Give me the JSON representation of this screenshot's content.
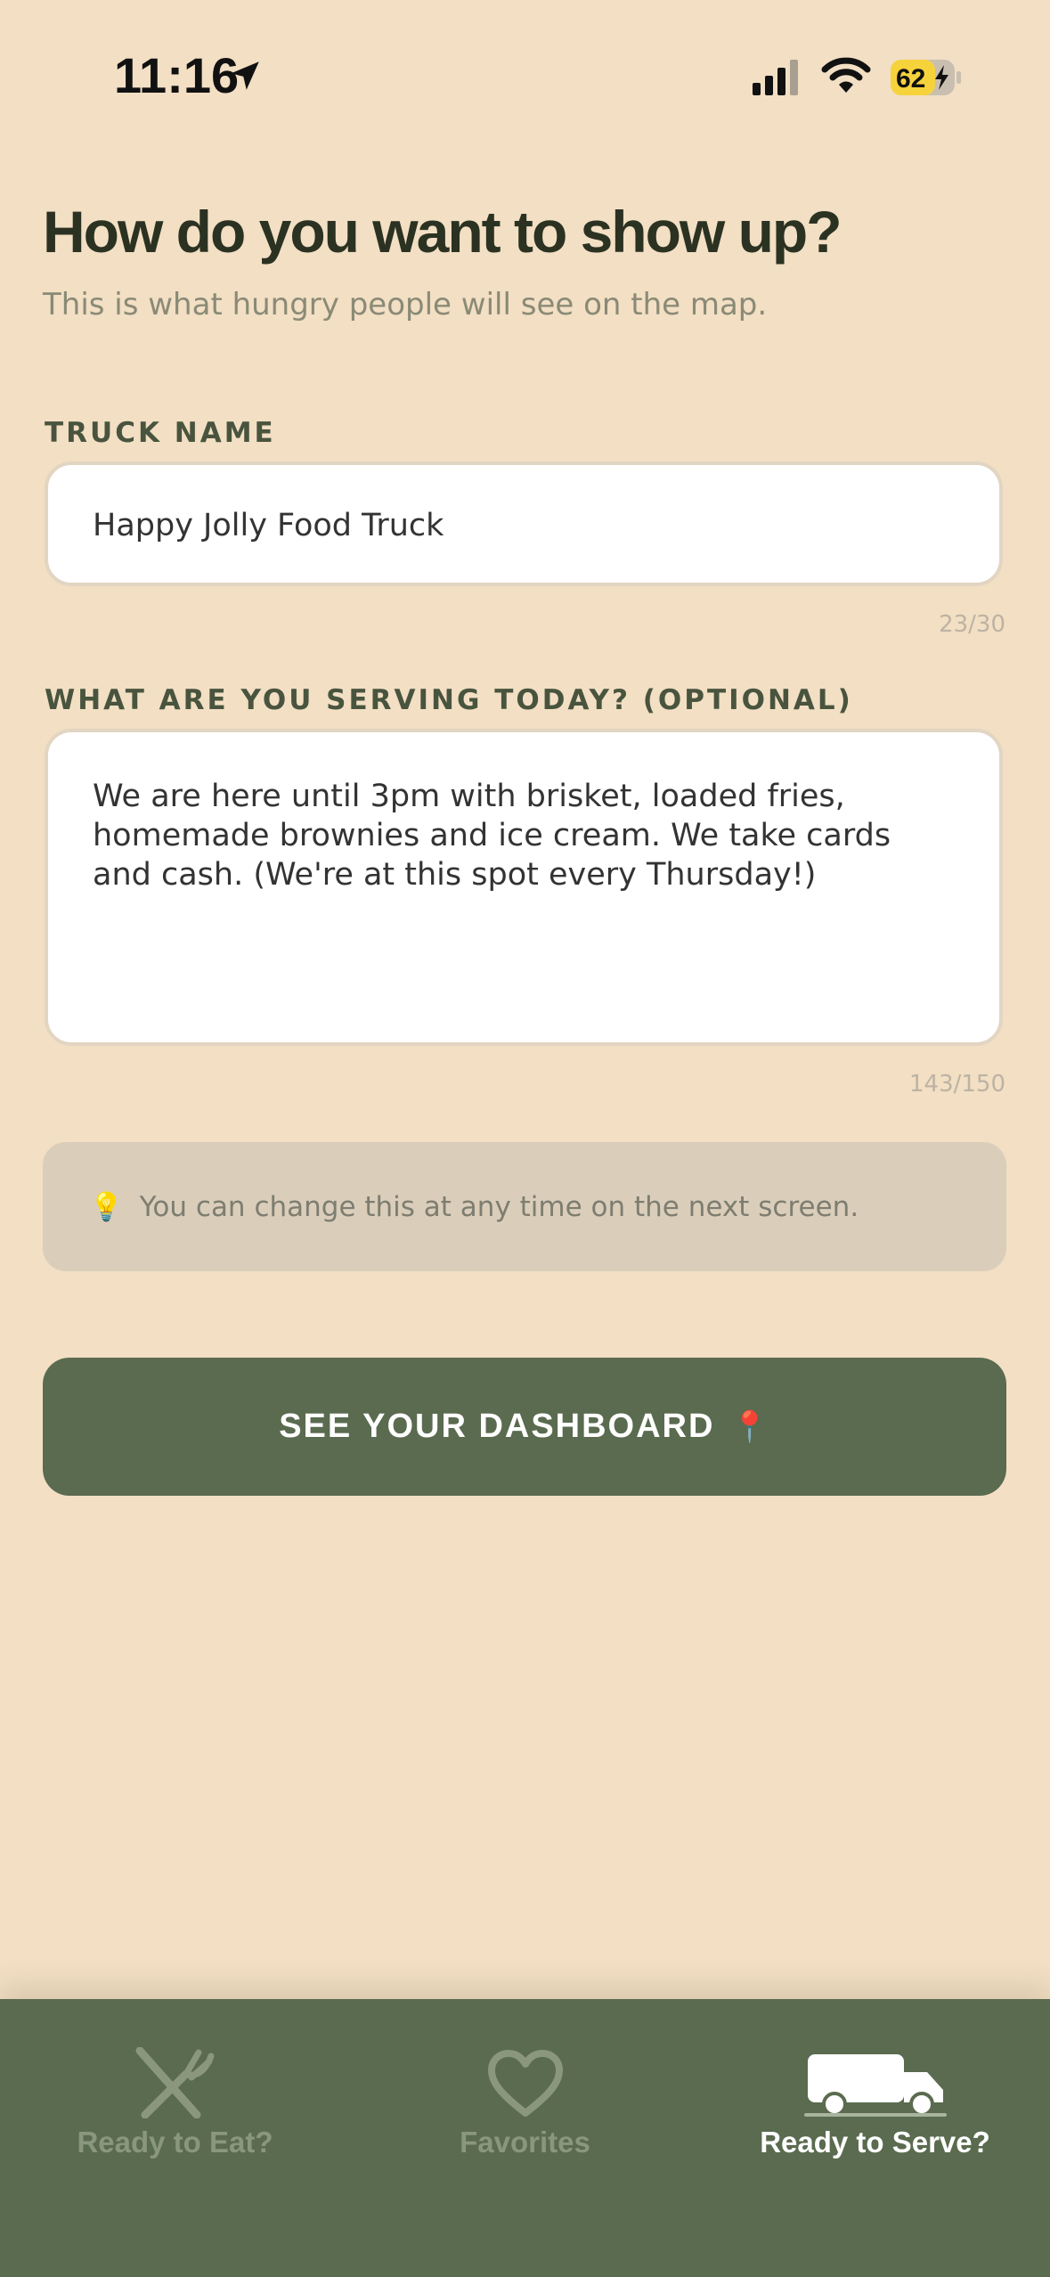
{
  "status_bar": {
    "time": "11:16",
    "battery_percent": "62",
    "icons": [
      "location-arrow-icon",
      "signal-icon",
      "wifi-icon",
      "battery-charging-icon"
    ]
  },
  "header": {
    "title": "How do you want to show up?",
    "subtitle": "This is what hungry people will see on the map."
  },
  "truck_name": {
    "label": "TRUCK NAME",
    "value": "Happy Jolly Food Truck",
    "counter": "23/30"
  },
  "serving": {
    "label": "WHAT ARE YOU SERVING TODAY? (OPTIONAL)",
    "value": "We are here until 3pm with brisket, loaded fries, homemade brownies and ice cream. We take cards and cash. (We're at this spot every Thursday!)",
    "counter": "143/150"
  },
  "tip": {
    "icon": "lightbulb-icon",
    "emoji": "💡",
    "text": "You can change this at any time on the next screen."
  },
  "cta": {
    "label": "SEE YOUR DASHBOARD",
    "icon": "pin-icon",
    "emoji": "📍"
  },
  "tabs": [
    {
      "label": "Ready to Eat?",
      "icon": "fork-knife-icon",
      "active": false
    },
    {
      "label": "Favorites",
      "icon": "heart-icon",
      "active": false
    },
    {
      "label": "Ready to Serve?",
      "icon": "truck-icon",
      "active": true
    }
  ],
  "colors": {
    "background": "#F2DFC4",
    "accent": "#5A6B4F",
    "title": "#2B3222",
    "battery": "#F7D33B"
  }
}
